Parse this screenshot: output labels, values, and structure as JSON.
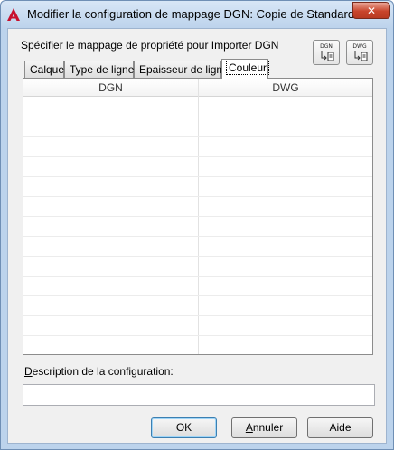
{
  "window": {
    "title": "Modifier la configuration de mappage DGN: Copie de Standard",
    "close_glyph": "✕",
    "app_icon": "autocad-logo-icon"
  },
  "instruction": "Spécifier le mappage de propriété pour Importer DGN",
  "toolbar": {
    "dgn_label": "DGN",
    "dwg_label": "DWG",
    "dgn_icon": "dgn-map-icon",
    "dwg_icon": "dwg-map-icon"
  },
  "tabs": [
    {
      "label": "Calque"
    },
    {
      "label": "Type de ligne"
    },
    {
      "label": "Epaisseur de ligne"
    },
    {
      "label": "Couleur",
      "active": true
    }
  ],
  "table": {
    "columns": [
      "DGN",
      "DWG"
    ],
    "rows": []
  },
  "description": {
    "label_prefix": "D",
    "label_rest": "escription de la configuration:",
    "value": ""
  },
  "buttons": {
    "ok": "OK",
    "cancel_prefix": "A",
    "cancel_rest": "nnuler",
    "help": "Aide"
  },
  "colors": {
    "title_bar": "#bdd3ec",
    "close_button": "#c9452c",
    "autocad_red": "#c8102e"
  }
}
